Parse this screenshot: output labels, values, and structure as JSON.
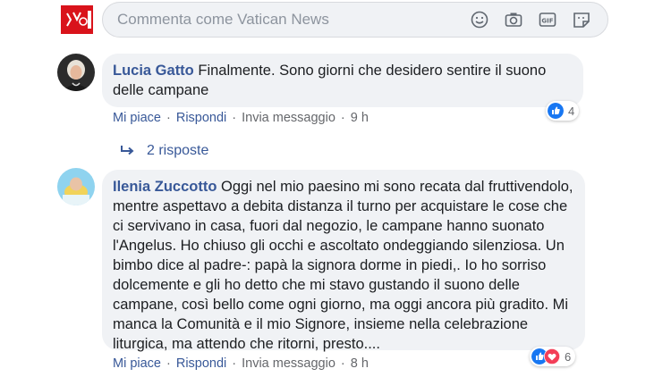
{
  "composer": {
    "placeholder": "Commenta come Vatican News",
    "icons": [
      "smiley-icon",
      "camera-icon",
      "gif-icon",
      "sticker-icon"
    ]
  },
  "comments": [
    {
      "author": "Lucia Gatto",
      "text": "Finalmente. Sono giorni che desidero sentire il suono delle campane",
      "actions": {
        "like": "Mi piace",
        "reply": "Rispondi",
        "message": "Invia messaggio",
        "time": "9 h"
      },
      "reactions": {
        "count": "4",
        "types": [
          "like"
        ]
      },
      "replies_label": "2 risposte"
    },
    {
      "author": "Ilenia Zuccotto",
      "text": "Oggi nel mio paesino mi sono recata dal fruttivendolo, mentre aspettavo a debita distanza il turno per acquistare le cose che ci servivano in casa, fuori dal negozio, le campane hanno suonato l'Angelus. Ho chiuso gli occhi e ascoltato ondeggiando silenziosa. Un bimbo dice al padre-: papà la signora dorme in piedi,. Io ho sorriso dolcemente e gli ho detto che mi stavo gustando il suono delle campane, così bello come ogni giorno, ma oggi ancora più gradito. Mi manca la Comunità e il mio Signore, insieme nella celebrazione liturgica, ma attendo che ritorni, presto....",
      "actions": {
        "like": "Mi piace",
        "reply": "Rispondi",
        "message": "Invia messaggio",
        "time": "8 h"
      },
      "reactions": {
        "count": "6",
        "types": [
          "like",
          "love"
        ]
      }
    }
  ],
  "colors": {
    "link": "#385898",
    "bubble": "#f0f2f5",
    "like": "#1877f2",
    "love": "#f33e58",
    "vatican_red": "#d9131b"
  }
}
